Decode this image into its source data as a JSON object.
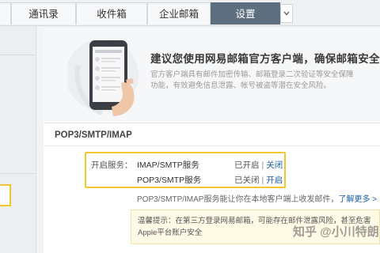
{
  "tabs": [
    {
      "label": "通讯录"
    },
    {
      "label": "收件箱"
    },
    {
      "label": "企业邮箱"
    },
    {
      "label": "设置"
    }
  ],
  "more_icon": "chevron-down",
  "promo": {
    "title": "建议您使用网易邮箱官方客户端，确保邮箱安全",
    "desc": "官方客户端具有邮件加密传输、邮箱登录二次验证等安全保障功能，有效避免信息泄露、帐号被盗等潜在安全风险。"
  },
  "section": {
    "title": "POP3/SMTP/IMAP"
  },
  "services": {
    "label": "开启服务：",
    "rows": [
      {
        "name": "IMAP/SMTP服务",
        "status": "已开启",
        "action": "关闭"
      },
      {
        "name": "POP3/SMTP服务",
        "status": "已关闭",
        "action": "开启"
      }
    ],
    "note": "POP3/SMTP/IMAP服务能让你在本地客户端上收发邮件，",
    "learn_more": "了解更多 >"
  },
  "tip": {
    "text": "温馨提示：在第三方登录网易邮箱，可能存在邮件泄露风险，甚至危害Apple平台账户安全"
  },
  "watermark": "知乎 @小川特朗",
  "colors": {
    "active_tab": "#5d6e7f",
    "highlight_border": "#f2c533",
    "link": "#1e5ea8",
    "tip_bg": "#fffbe6"
  }
}
